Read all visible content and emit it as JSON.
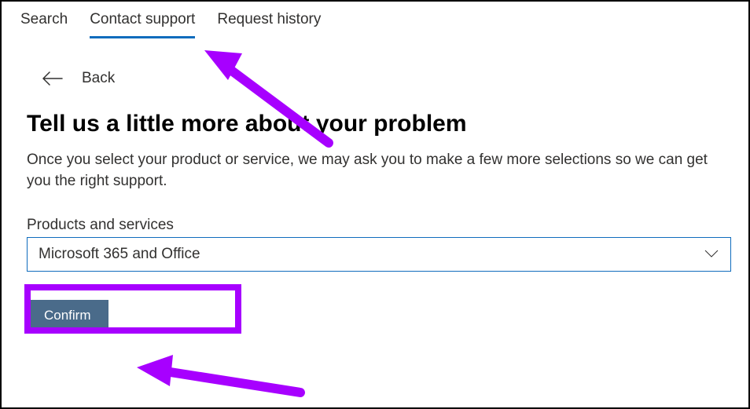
{
  "tabs": {
    "search": "Search",
    "contact_support": "Contact support",
    "request_history": "Request history"
  },
  "back": {
    "label": "Back"
  },
  "heading": "Tell us a little more about your problem",
  "description": "Once you select your product or service, we may ask you to make a few more selections so we can get you the right support.",
  "field_label": "Products and services",
  "select_value": "Microsoft 365 and Office",
  "confirm_label": "Confirm",
  "colors": {
    "accent": "#0f6cbd",
    "button": "#4a6b8a",
    "highlight": "#a700ff"
  }
}
